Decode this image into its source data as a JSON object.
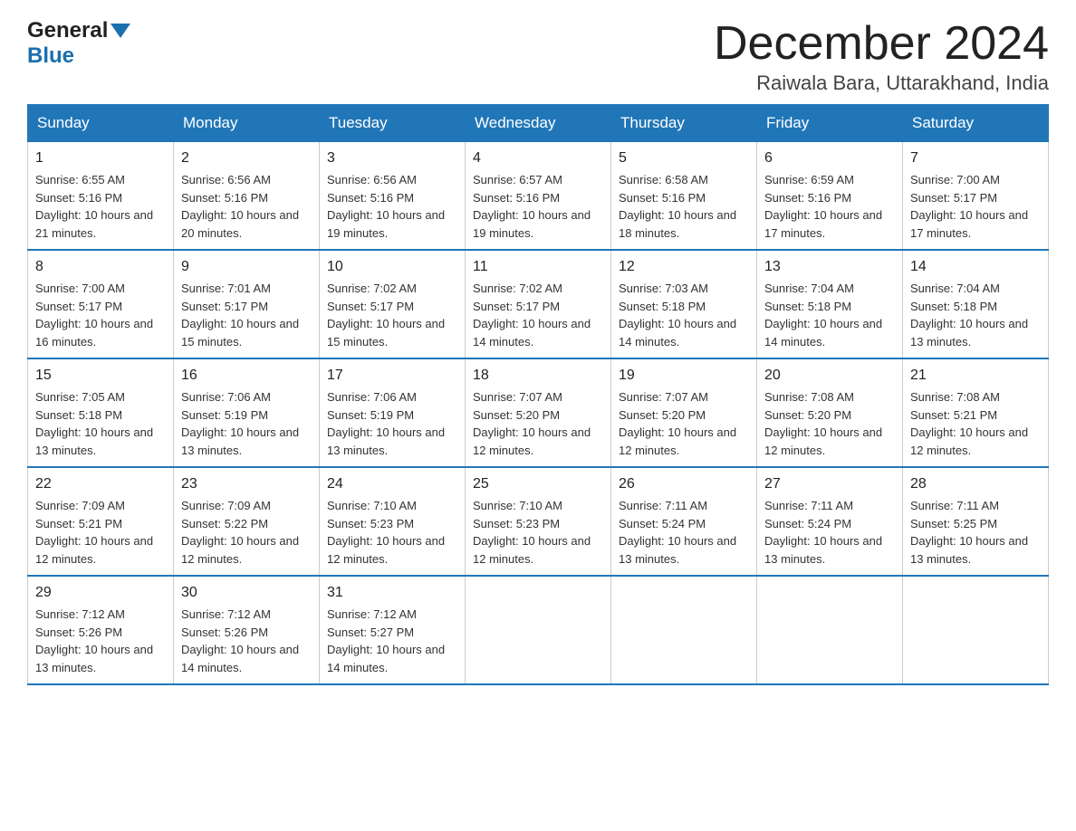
{
  "header": {
    "logo_general": "General",
    "logo_blue": "Blue",
    "month_title": "December 2024",
    "location": "Raiwala Bara, Uttarakhand, India"
  },
  "days_of_week": [
    "Sunday",
    "Monday",
    "Tuesday",
    "Wednesday",
    "Thursday",
    "Friday",
    "Saturday"
  ],
  "weeks": [
    [
      {
        "day": "1",
        "sunrise": "6:55 AM",
        "sunset": "5:16 PM",
        "daylight": "10 hours and 21 minutes."
      },
      {
        "day": "2",
        "sunrise": "6:56 AM",
        "sunset": "5:16 PM",
        "daylight": "10 hours and 20 minutes."
      },
      {
        "day": "3",
        "sunrise": "6:56 AM",
        "sunset": "5:16 PM",
        "daylight": "10 hours and 19 minutes."
      },
      {
        "day": "4",
        "sunrise": "6:57 AM",
        "sunset": "5:16 PM",
        "daylight": "10 hours and 19 minutes."
      },
      {
        "day": "5",
        "sunrise": "6:58 AM",
        "sunset": "5:16 PM",
        "daylight": "10 hours and 18 minutes."
      },
      {
        "day": "6",
        "sunrise": "6:59 AM",
        "sunset": "5:16 PM",
        "daylight": "10 hours and 17 minutes."
      },
      {
        "day": "7",
        "sunrise": "7:00 AM",
        "sunset": "5:17 PM",
        "daylight": "10 hours and 17 minutes."
      }
    ],
    [
      {
        "day": "8",
        "sunrise": "7:00 AM",
        "sunset": "5:17 PM",
        "daylight": "10 hours and 16 minutes."
      },
      {
        "day": "9",
        "sunrise": "7:01 AM",
        "sunset": "5:17 PM",
        "daylight": "10 hours and 15 minutes."
      },
      {
        "day": "10",
        "sunrise": "7:02 AM",
        "sunset": "5:17 PM",
        "daylight": "10 hours and 15 minutes."
      },
      {
        "day": "11",
        "sunrise": "7:02 AM",
        "sunset": "5:17 PM",
        "daylight": "10 hours and 14 minutes."
      },
      {
        "day": "12",
        "sunrise": "7:03 AM",
        "sunset": "5:18 PM",
        "daylight": "10 hours and 14 minutes."
      },
      {
        "day": "13",
        "sunrise": "7:04 AM",
        "sunset": "5:18 PM",
        "daylight": "10 hours and 14 minutes."
      },
      {
        "day": "14",
        "sunrise": "7:04 AM",
        "sunset": "5:18 PM",
        "daylight": "10 hours and 13 minutes."
      }
    ],
    [
      {
        "day": "15",
        "sunrise": "7:05 AM",
        "sunset": "5:18 PM",
        "daylight": "10 hours and 13 minutes."
      },
      {
        "day": "16",
        "sunrise": "7:06 AM",
        "sunset": "5:19 PM",
        "daylight": "10 hours and 13 minutes."
      },
      {
        "day": "17",
        "sunrise": "7:06 AM",
        "sunset": "5:19 PM",
        "daylight": "10 hours and 13 minutes."
      },
      {
        "day": "18",
        "sunrise": "7:07 AM",
        "sunset": "5:20 PM",
        "daylight": "10 hours and 12 minutes."
      },
      {
        "day": "19",
        "sunrise": "7:07 AM",
        "sunset": "5:20 PM",
        "daylight": "10 hours and 12 minutes."
      },
      {
        "day": "20",
        "sunrise": "7:08 AM",
        "sunset": "5:20 PM",
        "daylight": "10 hours and 12 minutes."
      },
      {
        "day": "21",
        "sunrise": "7:08 AM",
        "sunset": "5:21 PM",
        "daylight": "10 hours and 12 minutes."
      }
    ],
    [
      {
        "day": "22",
        "sunrise": "7:09 AM",
        "sunset": "5:21 PM",
        "daylight": "10 hours and 12 minutes."
      },
      {
        "day": "23",
        "sunrise": "7:09 AM",
        "sunset": "5:22 PM",
        "daylight": "10 hours and 12 minutes."
      },
      {
        "day": "24",
        "sunrise": "7:10 AM",
        "sunset": "5:23 PM",
        "daylight": "10 hours and 12 minutes."
      },
      {
        "day": "25",
        "sunrise": "7:10 AM",
        "sunset": "5:23 PM",
        "daylight": "10 hours and 12 minutes."
      },
      {
        "day": "26",
        "sunrise": "7:11 AM",
        "sunset": "5:24 PM",
        "daylight": "10 hours and 13 minutes."
      },
      {
        "day": "27",
        "sunrise": "7:11 AM",
        "sunset": "5:24 PM",
        "daylight": "10 hours and 13 minutes."
      },
      {
        "day": "28",
        "sunrise": "7:11 AM",
        "sunset": "5:25 PM",
        "daylight": "10 hours and 13 minutes."
      }
    ],
    [
      {
        "day": "29",
        "sunrise": "7:12 AM",
        "sunset": "5:26 PM",
        "daylight": "10 hours and 13 minutes."
      },
      {
        "day": "30",
        "sunrise": "7:12 AM",
        "sunset": "5:26 PM",
        "daylight": "10 hours and 14 minutes."
      },
      {
        "day": "31",
        "sunrise": "7:12 AM",
        "sunset": "5:27 PM",
        "daylight": "10 hours and 14 minutes."
      },
      null,
      null,
      null,
      null
    ]
  ]
}
